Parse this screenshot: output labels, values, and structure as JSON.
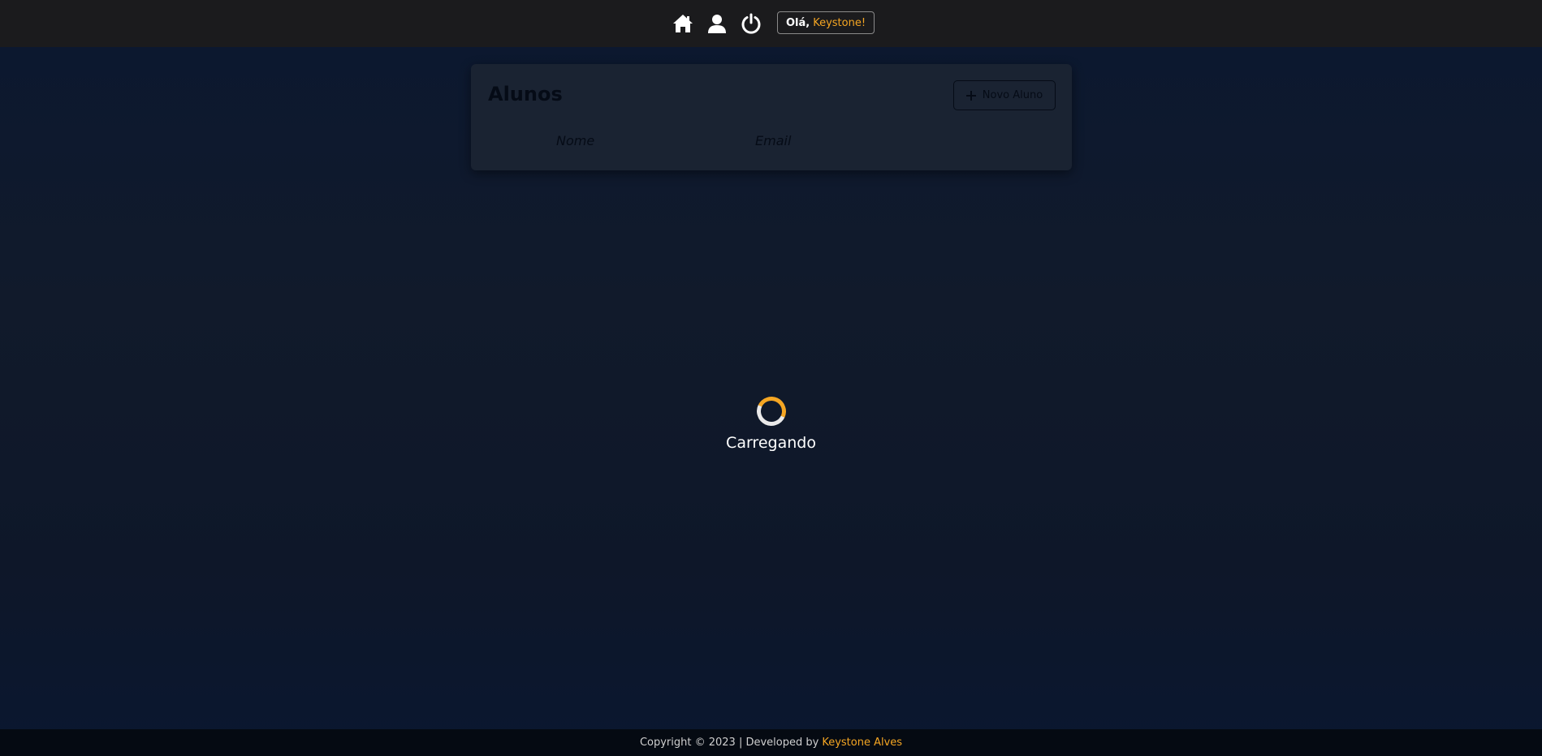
{
  "topbar": {
    "icons": [
      "home-icon",
      "user-icon",
      "power-icon"
    ],
    "greeting_prefix": "Olá,",
    "greeting_name": "Keystone!"
  },
  "card": {
    "title": "Alunos",
    "new_button_label": "Novo Aluno",
    "columns": [
      "Nome",
      "Email"
    ]
  },
  "loader": {
    "text": "Carregando"
  },
  "footer": {
    "text": "Copyright © 2023 | Developed by",
    "author": "Keystone Alves"
  },
  "colors": {
    "accent": "#f5a623",
    "topbar": "#1b1b1d",
    "card": "#1a2332",
    "footer": "#050a12"
  }
}
